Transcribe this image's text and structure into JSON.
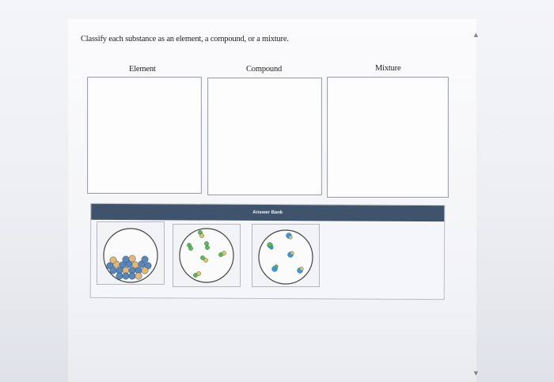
{
  "question": {
    "prompt": "Classify each substance as an element, a compound, or a mixture."
  },
  "categories": [
    {
      "label": "Element"
    },
    {
      "label": "Compound"
    },
    {
      "label": "Mixture"
    }
  ],
  "answer_bank": {
    "title": "Answer Bank",
    "items": [
      {
        "name": "element-particles-item",
        "description_icon": "packed-atoms-icon"
      },
      {
        "name": "compound-molecules-item",
        "description_icon": "diatomic-molecules-icon"
      },
      {
        "name": "mixture-particles-item",
        "description_icon": "mixed-particles-icon"
      }
    ]
  },
  "icons": {
    "scroll_up": "▲",
    "scroll_down": "▼"
  },
  "colors": {
    "bank_header": "#3f536c",
    "atom_blue": "#5b86b8",
    "atom_tan": "#e2b873",
    "molecule_green": "#5cb85c",
    "molecule_teal": "#3a9ad9"
  }
}
